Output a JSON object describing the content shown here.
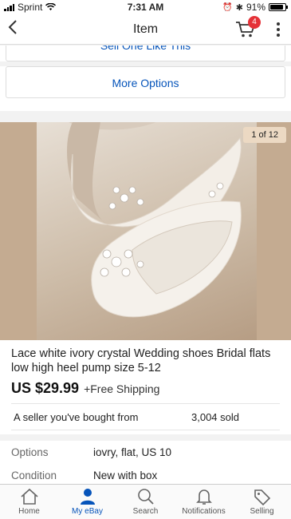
{
  "status_bar": {
    "carrier": "Sprint",
    "time": "7:31 AM",
    "battery": "91%",
    "battery_level": 0.91
  },
  "nav": {
    "title": "Item",
    "cart_count": "4"
  },
  "actions": {
    "sell_one": "Sell One Like This",
    "more_options": "More Options"
  },
  "gallery": {
    "counter": "1 of 12"
  },
  "item": {
    "title": "Lace white ivory crystal Wedding shoes Bridal flats low high heel pump size 5-12",
    "price": "US $29.99",
    "shipping": "+Free Shipping",
    "seller_note": "A seller you've bought from",
    "sold": "3,004 sold"
  },
  "specs": [
    {
      "key": "Options",
      "value": "iovry, flat, US 10"
    },
    {
      "key": "Condition",
      "value": "New with box"
    }
  ],
  "tabs": [
    {
      "label": "Home",
      "icon": "home-icon"
    },
    {
      "label": "My eBay",
      "icon": "person-icon"
    },
    {
      "label": "Search",
      "icon": "search-icon"
    },
    {
      "label": "Notifications",
      "icon": "bell-icon"
    },
    {
      "label": "Selling",
      "icon": "tag-icon"
    }
  ],
  "colors": {
    "accent": "#0654ba",
    "badge": "#e53238"
  }
}
